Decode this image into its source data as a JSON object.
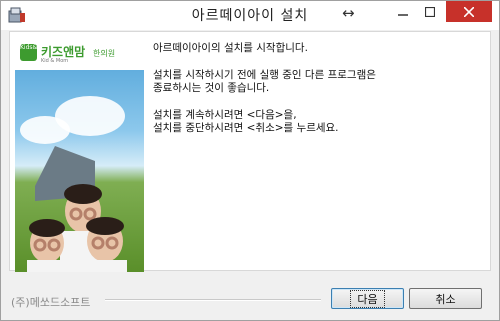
{
  "window": {
    "title": "아르떼이아이 설치"
  },
  "banner": {
    "logo_mark": "Kids&Mom",
    "logo_name": "키즈앤맘",
    "logo_sub": "Kid & Mom",
    "logo_right": "한의원"
  },
  "body": {
    "paragraph1": "아르떼이아이의 설치를 시작합니다.",
    "paragraph2": "설치를 시작하시기 전에 실행 중인 다른 프로그램은\n종료하시는 것이 좋습니다.",
    "paragraph3": "설치를 계속하시려면 <다음>을,\n설치를 중단하시려면 <취소>를 누르세요."
  },
  "footer": {
    "company": "(주)메쏘드소프트",
    "next_label": "다음",
    "cancel_label": "취소"
  },
  "icons": {
    "app": "installer-icon",
    "move": "move-arrows-icon",
    "minimize": "minimize-icon",
    "maximize": "maximize-icon",
    "close": "close-icon"
  }
}
